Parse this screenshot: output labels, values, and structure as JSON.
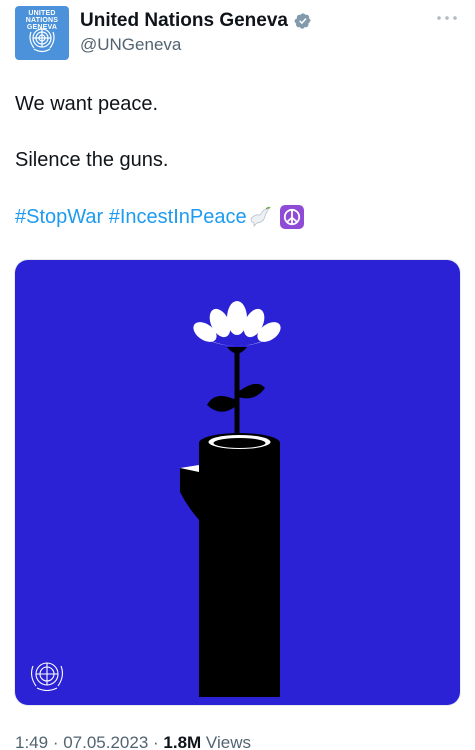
{
  "account": {
    "avatar_tag": "UNITED NATIONS\nGENEVA",
    "display_name": "United Nations Geneva",
    "handle": "@UNGeneva",
    "verified": true
  },
  "tweet": {
    "line1": "We want peace.",
    "line2": "Silence the guns.",
    "hashtags": [
      "#StopWar",
      "#IncestInPeace"
    ],
    "emojis": [
      "dove-emoji",
      "peace-symbol-emoji"
    ]
  },
  "media": {
    "description_icons": [
      "flower-illustration",
      "gun-barrel-illustration",
      "un-emblem-icon"
    ],
    "background_color": "#2b22d6"
  },
  "footer": {
    "time": "1:49",
    "sep1": " · ",
    "date": "07.05.2023",
    "sep2": " · ",
    "views_count": "1.8M",
    "views_label": " Views"
  },
  "colors": {
    "link": "#1d9bf0",
    "secondary_text": "#536471",
    "primary_text": "#0f1419",
    "verified_badge": "#829aab",
    "avatar_bg": "#4b92db"
  }
}
